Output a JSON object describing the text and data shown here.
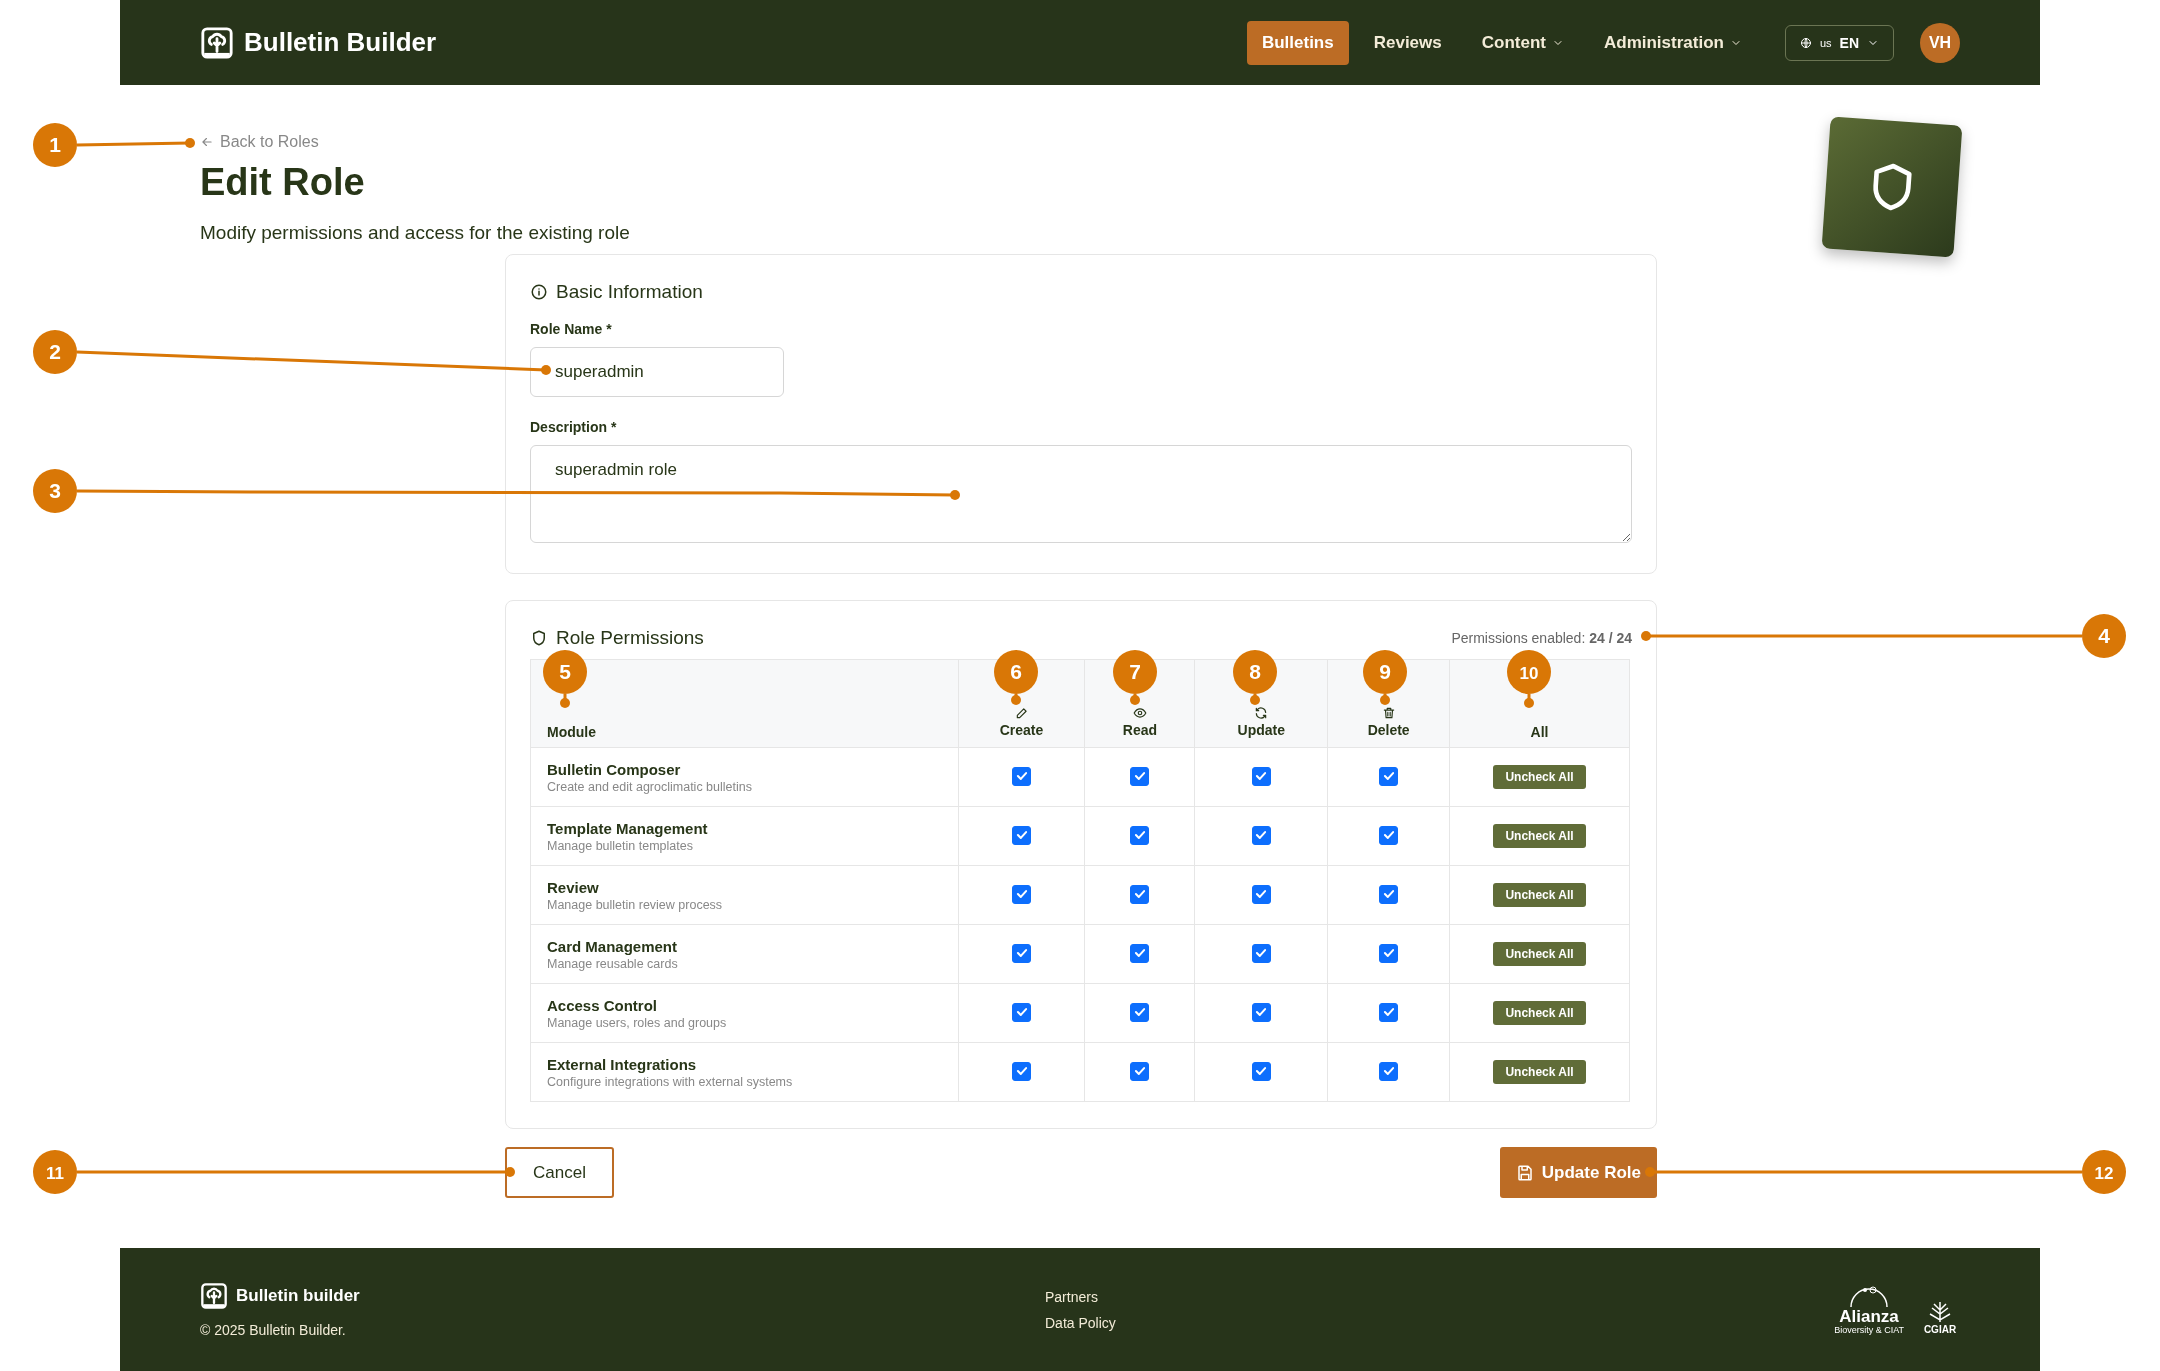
{
  "header": {
    "brand": "Bulletin Builder",
    "nav": [
      {
        "label": "Bulletins",
        "selected": true,
        "dropdown": false
      },
      {
        "label": "Reviews",
        "selected": false,
        "dropdown": false
      },
      {
        "label": "Content",
        "selected": false,
        "dropdown": true
      },
      {
        "label": "Administration",
        "selected": false,
        "dropdown": true
      }
    ],
    "language": {
      "flag": "us",
      "code": "EN"
    },
    "avatar": "VH"
  },
  "back_link": "Back to Roles",
  "title": "Edit Role",
  "subtitle": "Modify permissions and access for the existing role",
  "basic_info": {
    "heading": "Basic Information",
    "fields": [
      {
        "label": "Role Name *",
        "value": "superadmin",
        "kind": "input"
      },
      {
        "label": "Description *",
        "value": "superadmin role",
        "kind": "textarea"
      }
    ]
  },
  "permissions": {
    "heading": "Role Permissions",
    "summary": "Permissions enabled: **24 / 24**",
    "columns": [
      {
        "label": "Module",
        "kind": "module"
      },
      {
        "label": "Create",
        "kind": "create"
      },
      {
        "label": "Read",
        "kind": "read"
      },
      {
        "label": "Update",
        "kind": "update"
      },
      {
        "label": "Delete",
        "kind": "delete"
      },
      {
        "label": "All",
        "kind": "all"
      }
    ],
    "rows": [
      {
        "name": "Bulletin Composer",
        "description": "Create and edit agroclimatic bulletins",
        "checks": [
          {
            "checked": true
          },
          {
            "checked": true
          },
          {
            "checked": true
          },
          {
            "checked": true
          }
        ],
        "action": "Uncheck All"
      },
      {
        "name": "Template Management",
        "description": "Manage bulletin templates",
        "checks": [
          {
            "checked": true
          },
          {
            "checked": true
          },
          {
            "checked": true
          },
          {
            "checked": true
          }
        ],
        "action": "Uncheck All"
      },
      {
        "name": "Review",
        "description": "Manage bulletin review process",
        "checks": [
          {
            "checked": true
          },
          {
            "checked": true
          },
          {
            "checked": true
          },
          {
            "checked": true
          }
        ],
        "action": "Uncheck All"
      },
      {
        "name": "Card Management",
        "description": "Manage reusable cards",
        "checks": [
          {
            "checked": true
          },
          {
            "checked": true
          },
          {
            "checked": true
          },
          {
            "checked": true
          }
        ],
        "action": "Uncheck All"
      },
      {
        "name": "Access Control",
        "description": "Manage users, roles and groups",
        "checks": [
          {
            "checked": true
          },
          {
            "checked": true
          },
          {
            "checked": true
          },
          {
            "checked": true
          }
        ],
        "action": "Uncheck All"
      },
      {
        "name": "External Integrations",
        "description": "Configure integrations with external systems",
        "checks": [
          {
            "checked": true
          },
          {
            "checked": true
          },
          {
            "checked": true
          },
          {
            "checked": true
          }
        ],
        "action": "Uncheck All"
      }
    ]
  },
  "actions": {
    "cancel": "Cancel",
    "submit": "Update Role"
  },
  "footer": {
    "brand": "Bulletin builder",
    "copyright": "© 2025 Bulletin Builder.",
    "links": [
      "Partners",
      "Data Policy"
    ],
    "partners": [
      {
        "name": "Alianza",
        "subtitle": "Bioversity & CIAT"
      },
      {
        "name": "CGIAR"
      }
    ]
  },
  "callouts": [
    "1",
    "2",
    "3",
    "4",
    "5",
    "6",
    "7",
    "8",
    "9",
    "10",
    "11",
    "12"
  ]
}
